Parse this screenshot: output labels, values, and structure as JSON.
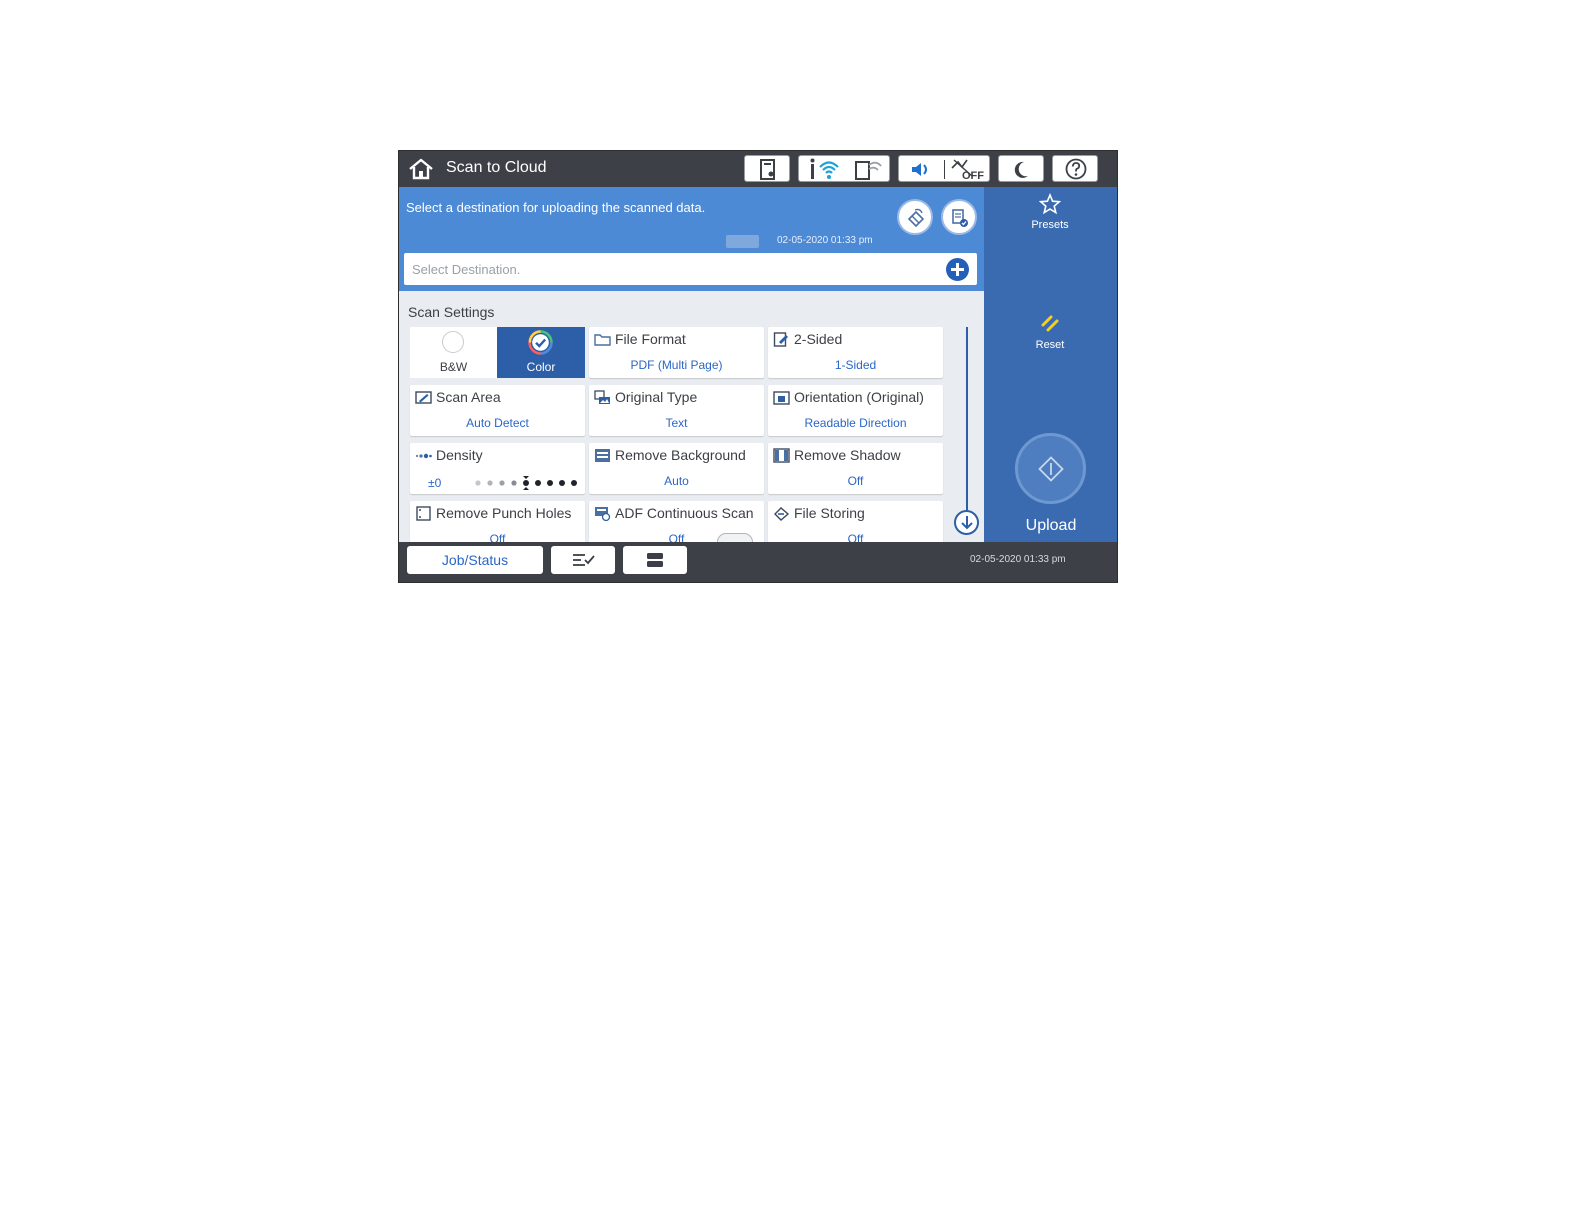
{
  "topbar": {
    "title": "Scan to Cloud",
    "icons": [
      "home-icon",
      "printer-status-icon",
      "wifi-icon",
      "wifi-direct-icon",
      "sound-icon",
      "quiet-mode-off-icon",
      "sleep-icon",
      "help-icon"
    ],
    "quiet_mode_label": "OFF"
  },
  "header": {
    "instruction": "Select a destination for uploading the scanned data.",
    "datetime": "02-05-2020 01:33 pm",
    "destination_placeholder": "Select Destination."
  },
  "settings": {
    "title": "Scan Settings",
    "color_mode": {
      "bw_label": "B&W",
      "color_label": "Color",
      "selected": "Color"
    },
    "tiles": [
      {
        "label": "File Format",
        "value": "PDF (Multi Page)"
      },
      {
        "label": "2-Sided",
        "value": "1-Sided"
      },
      {
        "label": "Scan Area",
        "value": "Auto Detect"
      },
      {
        "label": "Original Type",
        "value": "Text"
      },
      {
        "label": "Orientation (Original)",
        "value": "Readable Direction"
      },
      {
        "label": "Density",
        "value": "±0"
      },
      {
        "label": "Remove Background",
        "value": "Auto"
      },
      {
        "label": "Remove Shadow",
        "value": "Off"
      },
      {
        "label": "Remove Punch Holes",
        "value": "Off"
      },
      {
        "label": "ADF Continuous Scan",
        "value": "Off"
      },
      {
        "label": "File Storing",
        "value": "Off"
      }
    ],
    "density_level": 0
  },
  "rightpanel": {
    "presets_label": "Presets",
    "reset_label": "Reset",
    "upload_label": "Upload"
  },
  "bottombar": {
    "jobstatus_label": "Job/Status",
    "datetime": "02-05-2020 01:33 pm"
  },
  "colors": {
    "accent_blue": "#4c8ad6",
    "panel_blue": "#3a6bb0",
    "selected_blue": "#2c5fa8",
    "value_blue": "#2a66c9",
    "reset_yellow": "#f2d023",
    "bar_gray": "#3d4047"
  }
}
